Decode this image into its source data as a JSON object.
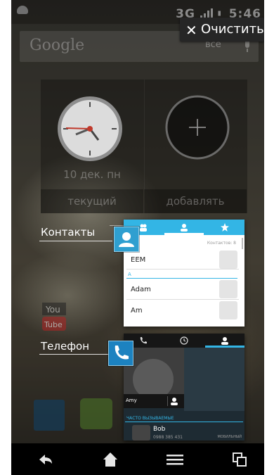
{
  "status_bar": {
    "network": "3G",
    "time": "5:46"
  },
  "google_bar": {
    "logo_text": "Google"
  },
  "clear_popup": {
    "icon": "close-icon",
    "label": "Очистить",
    "under_text": "все"
  },
  "widgets": {
    "clock": {
      "date": "10 дек. пн",
      "caption": "текущий"
    },
    "add": {
      "caption": "добавлять"
    }
  },
  "recent_apps": [
    {
      "label": "Контакты",
      "icon": "contacts-icon"
    },
    {
      "label": "Телефон",
      "icon": "phone-icon"
    }
  ],
  "contacts_thumb": {
    "count_label": "Контактов: 8",
    "rows": [
      {
        "section": "",
        "name": "ЕЕМ"
      },
      {
        "section": "A",
        "name": "Adam"
      },
      {
        "section": "",
        "name": "Am"
      }
    ]
  },
  "phone_thumb": {
    "contact_name": "Amy",
    "frequent_header": "ЧАСТО ВЫЗЫВАЕМЫЕ",
    "frequent": [
      {
        "name": "Bob",
        "number": "0988 385 431",
        "type": "МОБИЛЬНЫЙ"
      }
    ]
  },
  "nav_bar": [
    "back-icon",
    "home-icon",
    "menu-icon",
    "recent-apps-icon"
  ],
  "colors": {
    "accent": "#33b5e5",
    "navbar": "#000000",
    "contacts_badge": "#2f9fd0",
    "phone_badge": "#1c82c0"
  }
}
